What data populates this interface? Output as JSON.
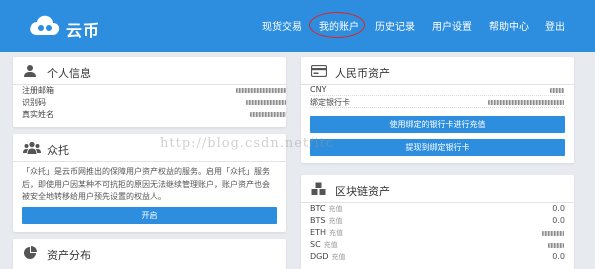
{
  "brand": {
    "name": "云币",
    "icon": "cloud-coin-logo-icon"
  },
  "nav": {
    "items": [
      {
        "key": "spot",
        "label": "现货交易"
      },
      {
        "key": "account",
        "label": "我的账户"
      },
      {
        "key": "history",
        "label": "历史记录"
      },
      {
        "key": "settings",
        "label": "用户设置"
      },
      {
        "key": "help",
        "label": "帮助中心"
      },
      {
        "key": "logout",
        "label": "登出"
      }
    ],
    "highlighted": "account",
    "highlight_color": "#e2231a"
  },
  "personal": {
    "title": "个人信息",
    "icon": "user-icon",
    "rows": [
      {
        "label": "注册邮箱",
        "value": ""
      },
      {
        "label": "识别码",
        "value": ""
      },
      {
        "label": "真实姓名",
        "value": ""
      }
    ]
  },
  "crowd": {
    "title": "众托",
    "icon": "group-icon",
    "description": "「众托」是云币网推出的保障用户资产权益的服务。启用「众托」服务后，即使用户因某种不可抗拒的原因无法继续管理账户，账户资产也会被安全地转移给用户预先设置的权益人。",
    "button": "开启"
  },
  "assets": {
    "title": "资产分布",
    "icon": "pie-chart-icon"
  },
  "cny": {
    "title": "人民币资产",
    "icon": "money-card-icon",
    "rows": [
      {
        "label": "CNY",
        "value": ""
      },
      {
        "label": "绑定银行卡",
        "value": ""
      }
    ],
    "deposit_button": "使用绑定的银行卡进行充值",
    "withdraw_button": "提现到绑定银行卡"
  },
  "chain": {
    "title": "区块链资产",
    "icon": "cubes-icon",
    "coins": [
      {
        "symbol": "BTC",
        "sub": "充值",
        "value": "0.0"
      },
      {
        "symbol": "BTS",
        "sub": "充值",
        "value": "0.0"
      },
      {
        "symbol": "ETH",
        "sub": "充值",
        "value": ""
      },
      {
        "symbol": "SC",
        "sub": "充值",
        "value": ""
      },
      {
        "symbol": "DGD",
        "sub": "充值",
        "value": "0.0"
      }
    ]
  },
  "watermark": "http://blog.csdn.net/itc",
  "colors": {
    "primary": "#2d8ee0",
    "background": "#e7eaef"
  }
}
